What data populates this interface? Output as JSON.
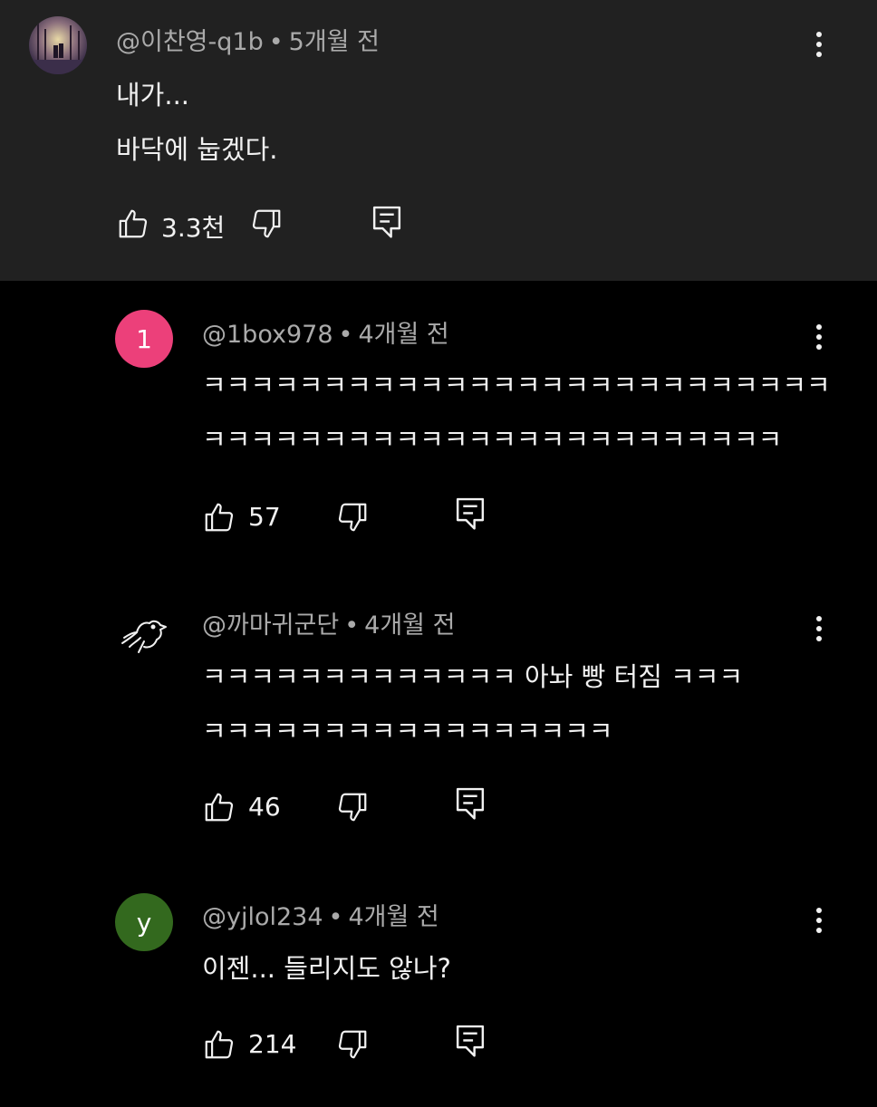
{
  "parent_comment": {
    "author": "@이찬영-q1b",
    "separator": "•",
    "time": "5개월 전",
    "lines": [
      "내가...",
      "바닥에 눕겠다."
    ],
    "like_count": "3.3천"
  },
  "replies": [
    {
      "avatar_letter": "1",
      "avatar_color": "#ec407a",
      "author": "@1box978",
      "time": "4개월 전",
      "lines": [
        "ㅋㅋㅋㅋㅋㅋㅋㅋㅋㅋㅋㅋㅋㅋㅋㅋㅋㅋㅋㅋㅋㅋㅋㅋㅋㅋ",
        "ㅋㅋㅋㅋㅋㅋㅋㅋㅋㅋㅋㅋㅋㅋㅋㅋㅋㅋㅋㅋㅋㅋㅋㅋ"
      ],
      "like_count": "57"
    },
    {
      "avatar_letter": "",
      "avatar_color": "#000000",
      "author": "@까마귀군단",
      "time": "4개월 전",
      "lines": [
        "ㅋㅋㅋㅋㅋㅋㅋㅋㅋㅋㅋㅋㅋ 아놔 빵 터짐 ㅋㅋㅋ",
        "ㅋㅋㅋㅋㅋㅋㅋㅋㅋㅋㅋㅋㅋㅋㅋㅋㅋ"
      ],
      "like_count": "46"
    },
    {
      "avatar_letter": "y",
      "avatar_color": "#33691e",
      "author": "@yjlol234",
      "time": "4개월 전",
      "lines": [
        "이젠... 들리지도 않나?"
      ],
      "like_count": "214"
    }
  ],
  "icons": {
    "like": "thumbs-up-icon",
    "dislike": "thumbs-down-icon",
    "reply": "reply-comment-icon",
    "more": "more-vert-icon"
  }
}
